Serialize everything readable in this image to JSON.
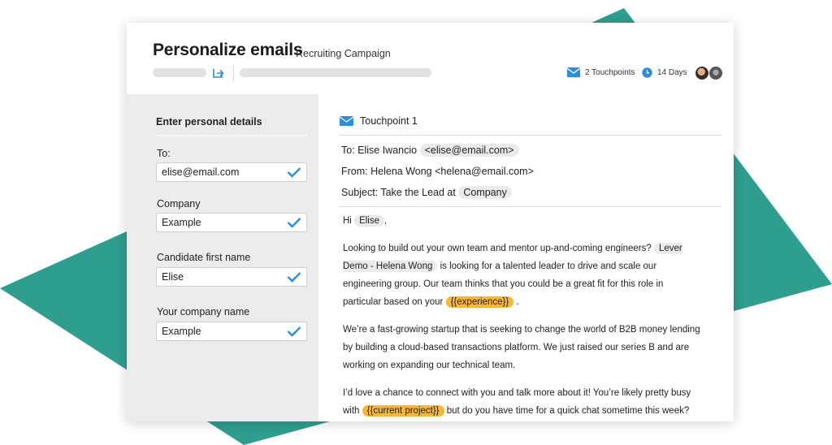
{
  "colors": {
    "teal": "#2e9e8f",
    "blue": "#2a8fe0",
    "orange_var": "#fbb733",
    "panel": "#ececec"
  },
  "header": {
    "title": "Personalize emails",
    "subtitle": "Recruiting Campaign",
    "touchpoints": "2 Touchpoints",
    "duration": "14 Days",
    "icons": [
      "share-icon",
      "envelope-icon",
      "clock-icon"
    ]
  },
  "left": {
    "heading": "Enter personal details",
    "fields": [
      {
        "label": "To:",
        "value": "elise@email.com"
      },
      {
        "label": "Company",
        "value": "Example"
      },
      {
        "label": "Candidate first name",
        "value": "Elise"
      },
      {
        "label": "Your company name",
        "value": "Example"
      }
    ]
  },
  "email": {
    "touchpoint": "Touchpoint 1",
    "to_prefix": "To: Elise Iwancio",
    "to_email": "<elise@email.com>",
    "from": "From: Helena Wong <helena@email.com>",
    "subject_prefix": "Subject: Take the Lead at",
    "subject_tag": "Company",
    "greeting_prefix": "Hi",
    "greeting_name": "Elise",
    "greeting_suffix": ",",
    "p1_a": "Looking to build out your own team and mentor up-and-coming engineers?",
    "p1_tag": "Lever Demo - Helena Wong",
    "p1_b": "is looking for a talented leader to drive and scale our engineering group. Our team thinks that you could be a great fit for this role in particular based on your",
    "p1_var": "{{experience}}",
    "p1_end": ".",
    "p2": "We’re a fast-growing startup that is seeking to change the world of B2B money lending by building a cloud-based transactions platform. We just raised our series B and are working on expanding our technical team.",
    "p3_a": "I’d love a chance to connect with you and talk more about it! You’re likely pretty busy with",
    "p3_var": "{{current project}}",
    "p3_b": "but do you have time for a quick chat sometime this week?"
  }
}
